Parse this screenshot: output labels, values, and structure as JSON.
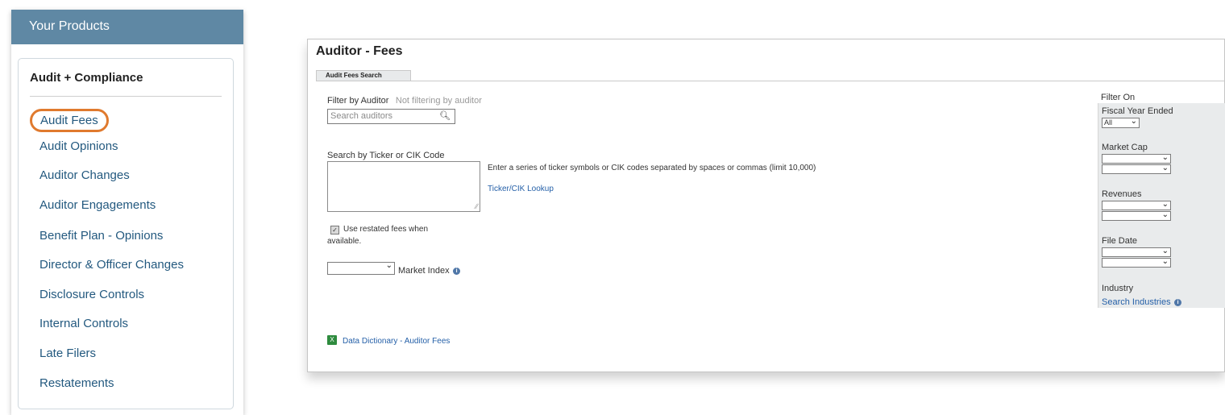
{
  "products": {
    "header": "Your Products",
    "category": "Audit + Compliance",
    "items": [
      {
        "label": "Audit Fees",
        "selected": true
      },
      {
        "label": "Audit Opinions",
        "selected": false
      },
      {
        "label": "Auditor Changes",
        "selected": false
      },
      {
        "label": "Auditor Engagements",
        "selected": false
      },
      {
        "label": "Benefit Plan - Opinions",
        "selected": false
      },
      {
        "label": "Director & Officer Changes",
        "selected": false
      },
      {
        "label": "Disclosure Controls",
        "selected": false
      },
      {
        "label": "Internal Controls",
        "selected": false
      },
      {
        "label": "Late Filers",
        "selected": false
      },
      {
        "label": "Restatements",
        "selected": false
      }
    ],
    "highlight_color": "#e07a2e"
  },
  "fees": {
    "title": "Auditor - Fees",
    "tab": "Audit Fees Search",
    "filter_by_auditor_label": "Filter by Auditor",
    "filter_status": "Not filtering by auditor",
    "search_auditors_placeholder": "Search auditors",
    "ticker_label": "Search by Ticker or CIK Code",
    "ticker_help": "Enter a series of ticker symbols or CIK codes separated by spaces or commas  (limit 10,000)",
    "ticker_lookup": "Ticker/CIK Lookup",
    "restated_line1": "Use restated fees when",
    "restated_line2": "available.",
    "market_index_label": "Market Index",
    "data_dictionary_link": "Data Dictionary - Auditor Fees"
  },
  "filter": {
    "title": "Filter On",
    "fiscal_year_ended": "Fiscal Year Ended",
    "fiscal_year_value": "All",
    "market_cap": "Market Cap",
    "revenues": "Revenues",
    "file_date": "File Date",
    "industry": "Industry",
    "search_industries": "Search Industries"
  },
  "colors": {
    "header_bg": "#5f88a4",
    "link": "#23597f",
    "accent_link": "#2560a8"
  }
}
